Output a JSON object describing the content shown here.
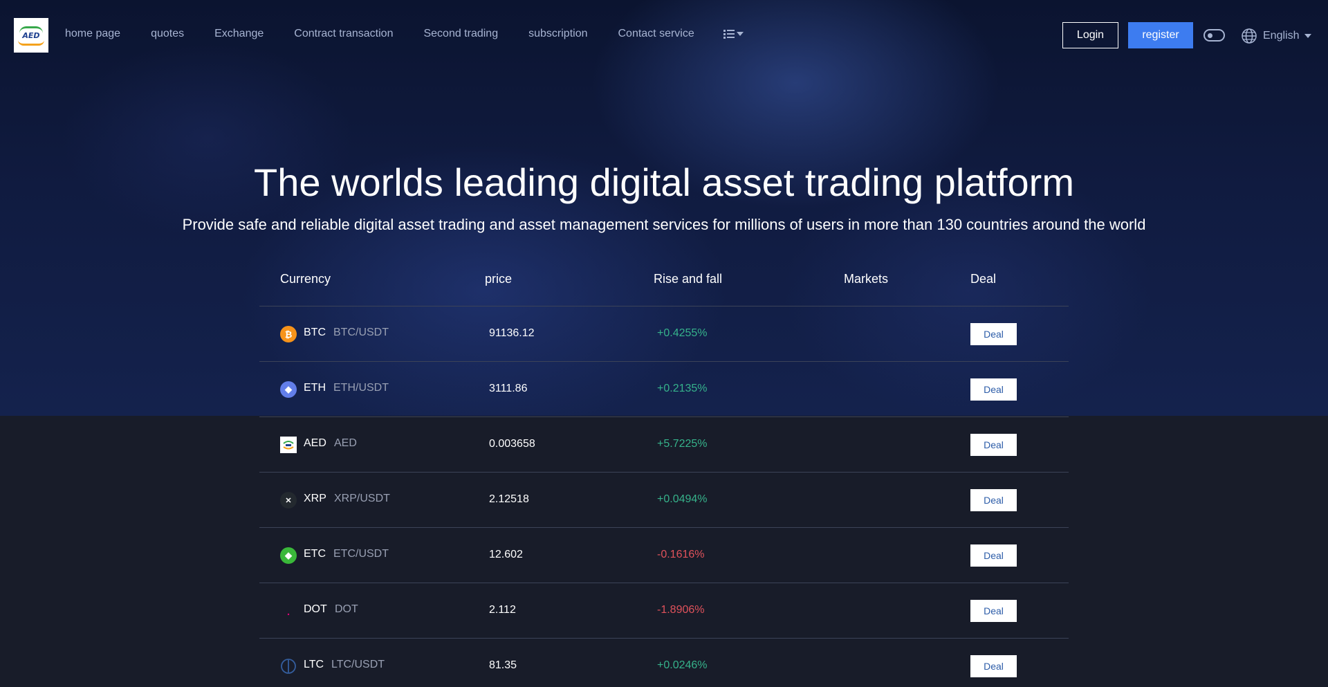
{
  "header": {
    "logo_text": "AED",
    "nav": [
      "home page",
      "quotes",
      "Exchange",
      "Contract transaction",
      "Second trading",
      "subscription",
      "Contact service"
    ],
    "login_label": "Login",
    "register_label": "register",
    "language": "English"
  },
  "hero": {
    "title": "The worlds leading digital asset trading platform",
    "subtitle": "Provide safe and reliable digital asset trading and asset management services for millions of users in more than 130 countries around the world"
  },
  "table": {
    "headers": {
      "currency": "Currency",
      "price": "price",
      "change": "Rise and fall",
      "markets": "Markets",
      "deal": "Deal"
    },
    "rows": [
      {
        "symbol": "BTC",
        "pair": "BTC/USDT",
        "price": "91136.12",
        "change": "+0.4255%",
        "direction": "up",
        "icon": "bitcoin-icon",
        "icon_color": "#f7931a",
        "glyph": "₿",
        "deal": "Deal"
      },
      {
        "symbol": "ETH",
        "pair": "ETH/USDT",
        "price": "3111.86",
        "change": "+0.2135%",
        "direction": "up",
        "icon": "ethereum-icon",
        "icon_color": "#627eea",
        "glyph": "◆",
        "deal": "Deal"
      },
      {
        "symbol": "AED",
        "pair": "AED",
        "price": "0.003658",
        "change": "+5.7225%",
        "direction": "up",
        "icon": "aed-logo-icon",
        "icon_color": "#ffffff",
        "glyph": "",
        "deal": "Deal"
      },
      {
        "symbol": "XRP",
        "pair": "XRP/USDT",
        "price": "2.12518",
        "change": "+0.0494%",
        "direction": "up",
        "icon": "xrp-icon",
        "icon_color": "#23292f",
        "glyph": "✕",
        "deal": "Deal"
      },
      {
        "symbol": "ETC",
        "pair": "ETC/USDT",
        "price": "12.602",
        "change": "-0.1616%",
        "direction": "down",
        "icon": "ethereum-classic-icon",
        "icon_color": "#3ab83a",
        "glyph": "◆",
        "deal": "Deal"
      },
      {
        "symbol": "DOT",
        "pair": "DOT",
        "price": "2.112",
        "change": "-1.8906%",
        "direction": "down",
        "icon": "polkadot-icon",
        "icon_color": "transparent",
        "glyph": "·",
        "deal": "Deal"
      },
      {
        "symbol": "LTC",
        "pair": "LTC/USDT",
        "price": "81.35",
        "change": "+0.0246%",
        "direction": "up",
        "icon": "litecoin-icon",
        "icon_color": "transparent",
        "glyph": "",
        "deal": "Deal"
      }
    ]
  },
  "colors": {
    "accent": "#3d7cf0",
    "up": "#36b38b",
    "down": "#e0525b",
    "background": "#181c29"
  }
}
